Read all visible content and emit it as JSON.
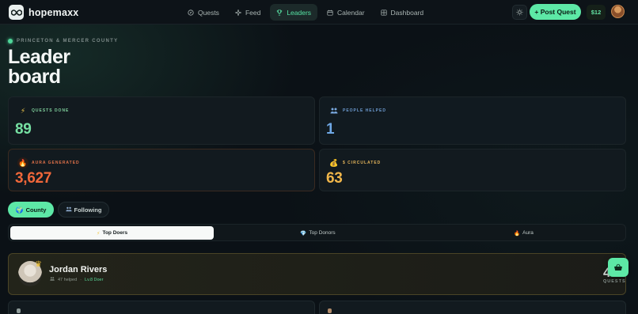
{
  "brand": {
    "name": "hopemaxx",
    "icon": "infinity-logo-icon"
  },
  "nav": {
    "links": [
      {
        "label": "Quests",
        "icon": "compass-icon"
      },
      {
        "label": "Feed",
        "icon": "sparkle-icon"
      },
      {
        "label": "Leaders",
        "icon": "trophy-icon",
        "active": true
      },
      {
        "label": "Calendar",
        "icon": "calendar-icon"
      },
      {
        "label": "Dashboard",
        "icon": "grid-icon"
      }
    ],
    "theme_icon": "sun-icon",
    "post_label": "+ Post Quest",
    "balance": "$12",
    "accent": "#5de8a6"
  },
  "header": {
    "region": "PRINCETON & MERCER COUNTY",
    "title": "Leader board"
  },
  "stats": [
    {
      "label": "QUESTS DONE",
      "value": "89",
      "icon": "lightning-icon",
      "color": "#76e0a2"
    },
    {
      "label": "PEOPLE HELPED",
      "value": "1",
      "icon": "people-icon",
      "color": "#6fa8e6"
    },
    {
      "label": "AURA GENERATED",
      "value": "3,627",
      "icon": "flame-icon",
      "color": "#f0673a"
    },
    {
      "label": "$ CIRCULATED",
      "value": "63",
      "icon": "money-bag-icon",
      "color": "#f0b64a"
    }
  ],
  "scope_toggle": [
    {
      "label": "County",
      "icon": "globe-icon",
      "active": true
    },
    {
      "label": "Following",
      "icon": "people-icon",
      "active": false
    }
  ],
  "subtabs": [
    {
      "label": "Top Doers",
      "icon": "lightning-icon",
      "active": true
    },
    {
      "label": "Top Donors",
      "icon": "gem-icon",
      "active": false
    },
    {
      "label": "Aura",
      "icon": "flame-icon",
      "active": false
    }
  ],
  "leader": {
    "name": "Jordan Rivers",
    "helped": "47 helped",
    "level": "Lv.8 Doer",
    "count": "4",
    "unit": "QUESTS",
    "badge_icon": "crown-icon"
  },
  "fab_icon": "basket-icon"
}
